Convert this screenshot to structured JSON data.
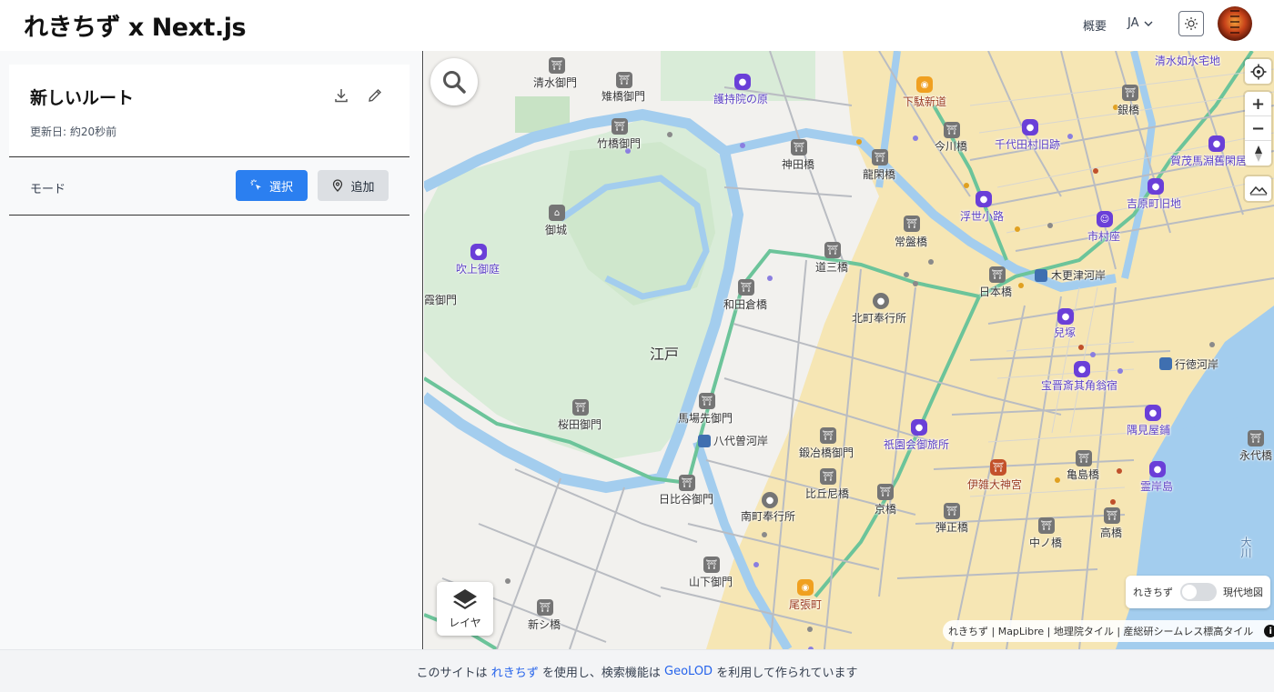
{
  "header": {
    "brand": "れきちず x Next.js",
    "nav_about": "概要",
    "lang": "JA"
  },
  "sidebar": {
    "route_title": "新しいルート",
    "route_updated": "更新日: 約20秒前",
    "mode_label": "モード",
    "select_label": "選択",
    "add_label": "追加"
  },
  "map": {
    "labels": {
      "shimizu_gomon": "清水御門",
      "chigohashi_gomon": "雉橋御門",
      "gojiin": "護持院の原",
      "takebashi_gomon": "竹橋御門",
      "kandabashi": "神田橋",
      "ryukanbashi": "龍閑橋",
      "shitamanshin": "下駄新道",
      "imagawabashi": "今川橋",
      "chiyoda": "千代田村旧跡",
      "kamo": "賀茂馬淵舊閑居",
      "kiyomizu": "清水如水宅地",
      "shirogane": "銀橋",
      "goshiro": "御城",
      "fukiage": "吹上御庭",
      "tokiwabashi": "常盤橋",
      "ukiyo": "浮世小路",
      "yoshiwara": "吉原町旧地",
      "ichimura": "市村座",
      "dosanbashi": "道三橋",
      "wadakura": "和田倉橋",
      "kitamachi": "北町奉行所",
      "nihonbashi": "日本橋",
      "kisarazu": "木更津河岸",
      "edo": "江戸",
      "kodzuka": "兒塚",
      "takarai": "宝晋斎其角翁宿",
      "gyotoku": "行徳河岸",
      "sakurada": "桜田御門",
      "babasaki": "馬場先御門",
      "yayosu": "八代曽河岸",
      "gion": "祇園会御旅所",
      "sumimi": "隅見屋鋪",
      "kajibashi": "鍛冶橋御門",
      "nagaoka": "永代橋",
      "hibiya": "日比谷御門",
      "bikuni": "比丘尼橋",
      "izaida": "伊雑大神宮",
      "kamejima": "亀島橋",
      "reiganjima": "霊岸島",
      "minamimachi": "南町奉行所",
      "kyobashi": "京橋",
      "danjo": "弾正橋",
      "takabashi": "高橋",
      "nakanohashi": "中ノ橋",
      "yamashita": "山下御門",
      "owari": "尾張町",
      "shinshi": "新シ橋",
      "kokan": "霞御門",
      "sumida": "大川"
    },
    "layer_label": "レイヤ",
    "toggle_left": "れきちず",
    "toggle_right": "現代地図",
    "attribution": "れきちず | MapLibre | 地理院タイル | 産総研シームレス標高タイル"
  },
  "footer": {
    "prefix": "このサイトは",
    "link1": "れきちず",
    "middle": "を使用し、検索機能は",
    "link2": "GeoLOD",
    "suffix": "を利用して作られています"
  },
  "colors": {
    "primary": "#2b7ff0",
    "water": "#a3cdee",
    "park": "#d9ecd8",
    "town": "#f6e6b4",
    "route": "#6cc49a"
  }
}
